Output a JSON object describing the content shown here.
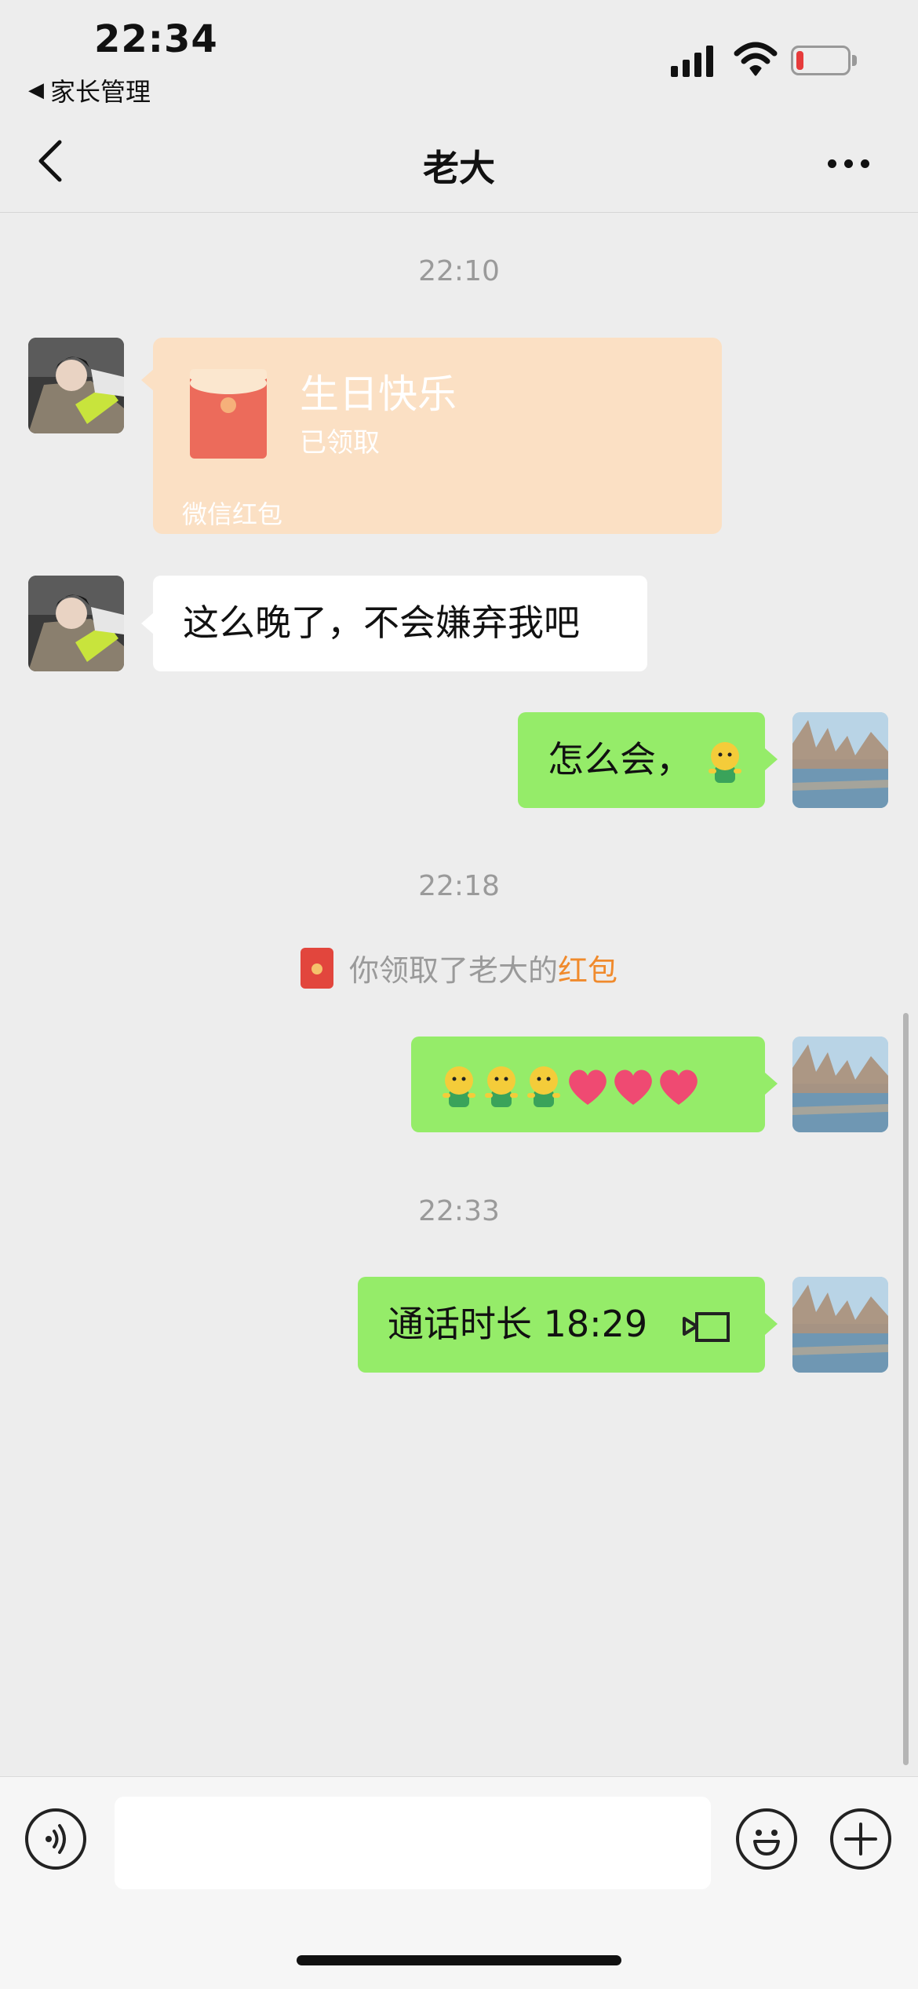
{
  "status_bar": {
    "time": "22:34",
    "back_app_label": "家长管理"
  },
  "nav": {
    "title": "老大"
  },
  "messages": {
    "ts1": "22:10",
    "red_packet": {
      "title": "生日快乐",
      "status": "已领取",
      "label": "微信红包"
    },
    "msg1": "这么晚了，不会嫌弃我吧",
    "msg2": "怎么会，",
    "ts2": "22:18",
    "notice_prefix": "你领取了老大的",
    "notice_highlight": "红包",
    "ts3": "22:33",
    "call_text": "通话时长 18:29"
  },
  "icons": {
    "back": "chevron-left-icon",
    "more": "more-dots-icon",
    "voice": "voice-icon",
    "emoji": "emoji-icon",
    "plus": "plus-icon",
    "video_call": "video-call-icon"
  },
  "colors": {
    "background": "#ededed",
    "green_bubble": "#95ec69",
    "red_packet": "#fbe0c4",
    "highlight": "#f08a2c"
  }
}
